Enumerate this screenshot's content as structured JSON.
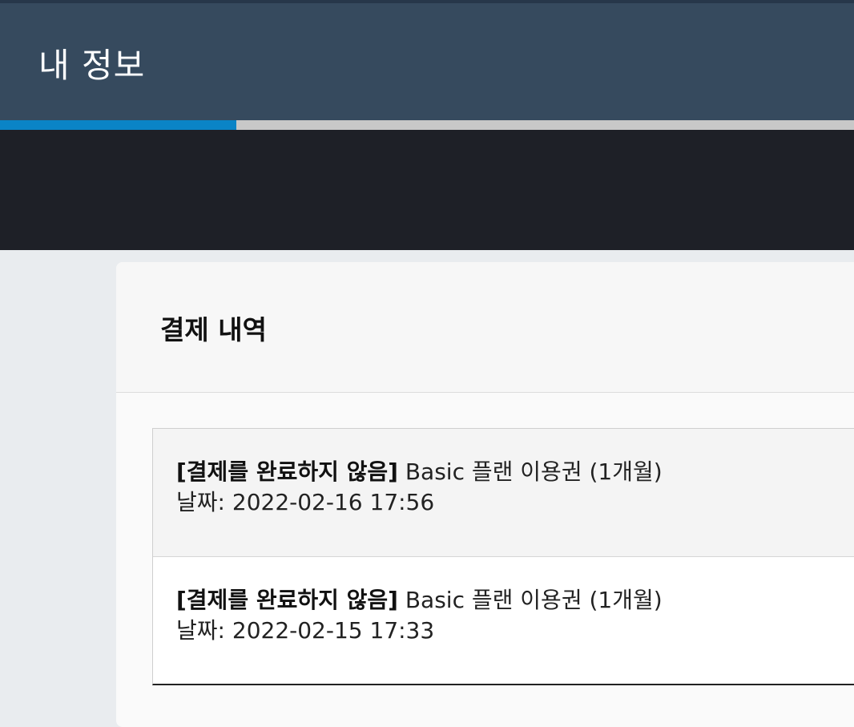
{
  "header": {
    "title": "내 정보"
  },
  "progress": {
    "fraction": 0.277,
    "fill_color": "#0a84c6",
    "track_color": "#c8c8c8"
  },
  "card": {
    "title": "결제 내역"
  },
  "payments": [
    {
      "status": "[결제를 완료하지 않음]",
      "item": "Basic 플랜 이용권 (1개월)",
      "date_label": "날짜:",
      "date": "2022-02-16 17:56"
    },
    {
      "status": "[결제를 완료하지 않음]",
      "item": "Basic 플랜 이용권 (1개월)",
      "date_label": "날짜:",
      "date": "2022-02-15 17:33"
    }
  ]
}
